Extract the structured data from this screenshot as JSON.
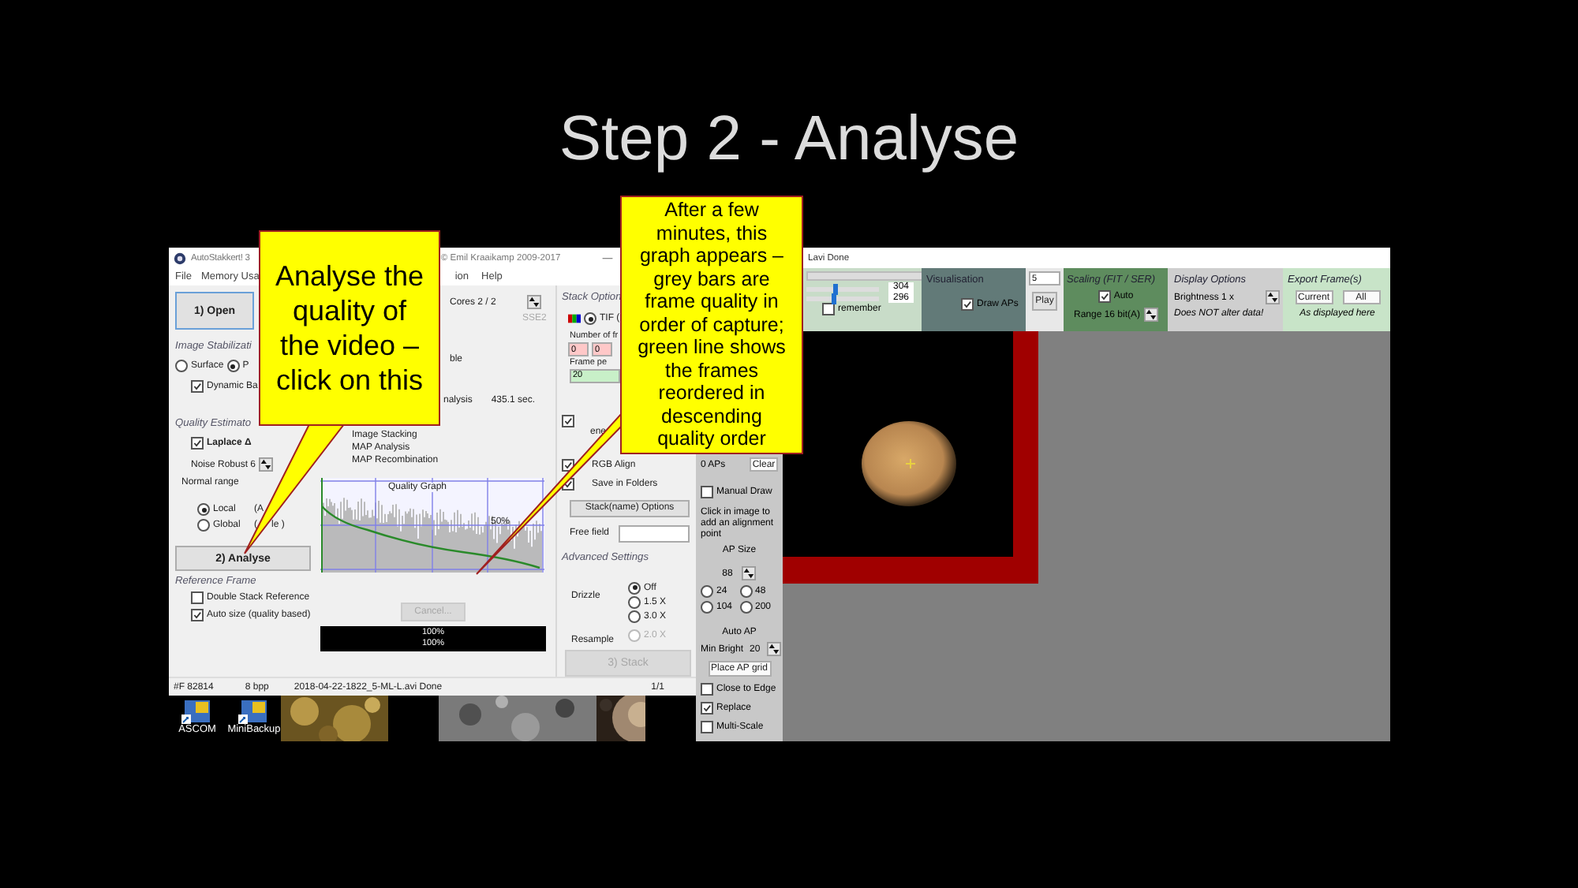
{
  "slide_title": "Step 2 - Analyse",
  "main_window": {
    "title": "AutoStakkert! 3",
    "copyright": "© Emil Kraaikamp 2009-2017",
    "menu": [
      "File",
      "Memory Usa",
      "ion",
      "Help"
    ],
    "open_button": "1) Open",
    "image_stabilization": {
      "heading": "Image Stabilizati",
      "options": [
        {
          "label": "Surface",
          "selected": false
        },
        {
          "label": "P",
          "selected": true
        }
      ],
      "dynamic": {
        "label": "Dynamic Ba",
        "checked": true
      }
    },
    "quality_estimator": {
      "heading": "Quality Estimato",
      "laplace": {
        "label": "Laplace Δ",
        "checked": true
      },
      "noise_robust": "Noise Robust  6",
      "normal_range": "Normal range",
      "scope": [
        {
          "label": "Local",
          "note": "(A",
          "selected": true
        },
        {
          "label": "Global",
          "note": "(",
          "note_tail": "le )",
          "selected": false
        }
      ]
    },
    "analyse_button": "2) Analyse",
    "reference_frame": {
      "heading": "Reference Frame",
      "options": [
        {
          "label": "Double Stack Reference",
          "checked": false
        },
        {
          "label": "Auto size (quality based)",
          "checked": true
        }
      ]
    },
    "cores": "Cores 2 / 2",
    "sse": "SSE2",
    "fragment": "ble",
    "analysis_label": "nalysis",
    "analysis_time": "435.1 sec.",
    "steps": [
      "Image Stacking",
      "MAP Analysis",
      "MAP Recombination"
    ],
    "quality_graph": {
      "title": "Quality Graph",
      "marker": "50%"
    },
    "cancel_button": {
      "label": "Cancel...",
      "disabled": true
    },
    "progress": [
      "100%",
      "100%"
    ],
    "stack_options": {
      "heading": "Stack Option",
      "format": {
        "label": "TIF (",
        "selected": true
      },
      "frames_label": "Number of fr",
      "frames": [
        "0",
        "0"
      ],
      "percent_label": "Frame pe",
      "percent": "20",
      "options": [
        {
          "label": "ene",
          "checked": true
        },
        {
          "label": "RGB Align",
          "checked": true
        },
        {
          "label": "Save in Folders",
          "checked": true
        }
      ],
      "name_button": "Stack(name) Options",
      "free_field": "Free field",
      "advanced": "Advanced Settings",
      "drizzle_label": "Drizzle",
      "drizzle": [
        {
          "label": "Off",
          "selected": true
        },
        {
          "label": "1.5 X",
          "selected": false
        },
        {
          "label": "3.0 X",
          "selected": false
        }
      ],
      "resample_label": "Resample",
      "resample": {
        "label": "2.0 X",
        "selected": false,
        "disabled": true
      },
      "stack_button": {
        "label": "3) Stack",
        "disabled": true
      }
    },
    "status_bar": [
      "#F 82814",
      "8 bpp",
      "2018-04-22-1822_5-ML-L.avi  Done",
      "1/1"
    ]
  },
  "desktop": {
    "icons": [
      "ASCOM",
      "MiniBackup"
    ]
  },
  "viewer_window": {
    "title": "Lavi  Done",
    "position_bar": {
      "level": 1
    },
    "sliders": [
      {
        "level": 0.4,
        "reading": "304"
      },
      {
        "level": 0.37,
        "reading": "296"
      }
    ],
    "remember": {
      "label": "remember",
      "checked": false
    },
    "visualisation": {
      "heading": "Visualisation",
      "draw_aps": {
        "label": "Draw APs",
        "checked": true
      }
    },
    "frame_field": "5",
    "play_button": "Play",
    "scaling": {
      "heading": "Scaling (FIT / SER)",
      "auto": {
        "label": "Auto",
        "checked": true
      },
      "range": "Range 16 bit(A)"
    },
    "display": {
      "heading": "Display Options",
      "brightness": "Brightness  1 x",
      "note": "Does NOT alter data!"
    },
    "export": {
      "heading": "Export Frame(s)",
      "buttons": [
        "Current",
        "All"
      ],
      "note": "As displayed here"
    },
    "ap_panel": {
      "count": "0 APs",
      "clear_button": "Clear",
      "manual_draw": {
        "label": "Manual Draw",
        "checked": false
      },
      "hint": "Click in image to add an alignment point",
      "size_heading": "AP Size",
      "size": "88",
      "sizes": [
        {
          "label": "24",
          "selected": false
        },
        {
          "label": "48",
          "selected": false
        },
        {
          "label": "104",
          "selected": false
        },
        {
          "label": "200",
          "selected": false
        }
      ],
      "auto_heading": "Auto AP",
      "min_bright": "Min Bright",
      "min_bright_value": "20",
      "grid_button": "Place AP grid",
      "options": [
        {
          "label": "Close to Edge",
          "checked": false
        },
        {
          "label": "Replace",
          "checked": true
        },
        {
          "label": "Multi-Scale",
          "checked": false
        }
      ]
    }
  },
  "callouts": [
    {
      "text": "Analyse the quality of the video – click on this"
    },
    {
      "text": "After a few minutes, this graph appears – grey bars are frame quality in order of capture; green line shows the frames reordered in descending quality order"
    }
  ]
}
